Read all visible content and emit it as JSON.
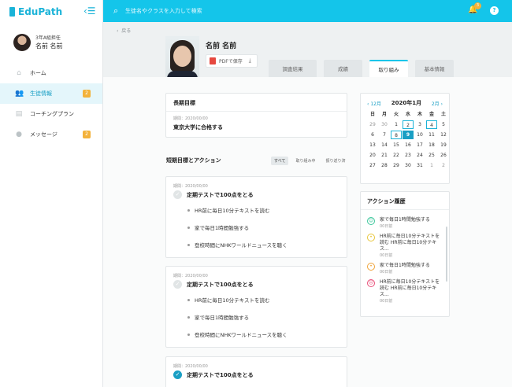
{
  "app": {
    "name": "EduPath"
  },
  "search": {
    "placeholder": "生徒名やクラスを入力して検索"
  },
  "notifications": {
    "count": "3"
  },
  "profile": {
    "role": "3年A組担任",
    "name": "名前 名前"
  },
  "nav": [
    {
      "label": "ホーム",
      "icon": "home-icon",
      "badge": ""
    },
    {
      "label": "生徒情報",
      "icon": "users-icon",
      "badge": "2"
    },
    {
      "label": "コーチングプラン",
      "icon": "book-icon",
      "badge": ""
    },
    {
      "label": "メッセージ",
      "icon": "chat-icon",
      "badge": "2"
    }
  ],
  "header": {
    "back": "戻る",
    "student_name": "名前 名前",
    "pdf_label": "PDFで保存"
  },
  "tabs": [
    "調査結果",
    "成績",
    "取り組み",
    "基本情報"
  ],
  "long_term": {
    "title": "長期目標",
    "period": "期間：2020/00/00",
    "goal": "東京大学に合格する"
  },
  "short_term": {
    "title": "短期目標とアクション",
    "filters": [
      "すべて",
      "取り組み中",
      "振り返り済"
    ],
    "goals": [
      {
        "period": "期間：2020/00/00",
        "title": "定期テストで100点をとる",
        "done": false,
        "actions": [
          "HR前に毎日10分テキストを読む",
          "家で毎日1時間勉強する",
          "登校時間にNHKワールドニュースを聴く"
        ]
      },
      {
        "period": "期間：2020/00/00",
        "title": "定期テストで100点をとる",
        "done": false,
        "actions": [
          "HR前に毎日10分テキストを読む",
          "家で毎日1時間勉強する",
          "登校時間にNHKワールドニュースを聴く"
        ]
      },
      {
        "period": "期間：2020/00/00",
        "title": "定期テストで100点をとる",
        "done": true,
        "actions": []
      }
    ]
  },
  "calendar": {
    "prev": "12月",
    "next": "2月",
    "title": "2020年1月",
    "weekdays": [
      "日",
      "月",
      "火",
      "水",
      "木",
      "金",
      "土"
    ],
    "days": [
      [
        "29",
        "30",
        "1",
        "2",
        "3",
        "4",
        "5"
      ],
      [
        "6",
        "7",
        "8",
        "9",
        "10",
        "11",
        "12"
      ],
      [
        "13",
        "14",
        "15",
        "16",
        "17",
        "18",
        "19"
      ],
      [
        "20",
        "21",
        "22",
        "23",
        "24",
        "25",
        "26"
      ],
      [
        "27",
        "28",
        "29",
        "30",
        "31",
        "1",
        "2"
      ]
    ]
  },
  "history": {
    "title": "アクション履歴",
    "items": [
      {
        "text": "家で毎日1時間勉強する",
        "meta": "00日前",
        "mood": "happy",
        "color": "#3fc79d"
      },
      {
        "text": "HR前に毎日10分テキストを読む HR前に毎日10分テキス...",
        "meta": "00日前",
        "mood": "neutral",
        "color": "#e8c63a"
      },
      {
        "text": "家で毎日1時間勉強する",
        "meta": "00日前",
        "mood": "ok",
        "color": "#f0a43a"
      },
      {
        "text": "HR前に毎日10分テキストを読む HR前に毎日10分テキス...",
        "meta": "00日前",
        "mood": "sad",
        "color": "#e9507a"
      }
    ]
  }
}
